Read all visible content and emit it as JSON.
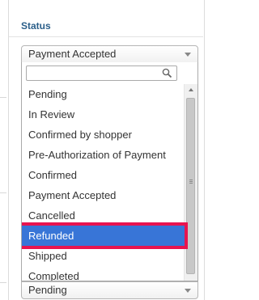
{
  "section": {
    "heading": "Status"
  },
  "status_select": {
    "value": "Payment Accepted"
  },
  "dropdown": {
    "search": {
      "value": "",
      "icon": "search-icon"
    },
    "options": [
      {
        "label": "Pending",
        "state": "normal"
      },
      {
        "label": "In Review",
        "state": "normal"
      },
      {
        "label": "Confirmed by shopper",
        "state": "normal"
      },
      {
        "label": "Pre-Authorization of Payment",
        "state": "normal"
      },
      {
        "label": "Confirmed",
        "state": "normal"
      },
      {
        "label": "Payment Accepted",
        "state": "normal"
      },
      {
        "label": "Cancelled",
        "state": "normal"
      },
      {
        "label": "Refunded",
        "state": "highlighted"
      },
      {
        "label": "Shipped",
        "state": "normal"
      },
      {
        "label": "Completed",
        "state": "normal"
      }
    ]
  },
  "secondary_select": {
    "value": "Pending"
  },
  "colors": {
    "highlight": "#3875d7",
    "annotation_box": "#e8144f",
    "heading": "#2b5f8a"
  }
}
